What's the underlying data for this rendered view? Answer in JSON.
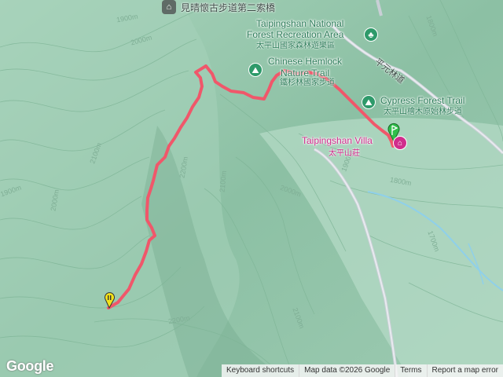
{
  "map": {
    "pois": {
      "bridge": {
        "name": "見晴懷古步道第二索橋",
        "icon": "bridge-icon"
      },
      "recreation_area": {
        "name_en_1": "Taipingshan National",
        "name_en_2": "Forest Recreation Area",
        "name_zh": "太平山國家森林遊樂區",
        "icon": "tree-icon"
      },
      "hemlock_trail": {
        "name_en_1": "Chinese Hemlock",
        "name_en_2": "Nature Trail",
        "name_zh": "鐵杉林國家步道",
        "icon": "hiking-icon"
      },
      "cypress_trail": {
        "name_en": "Cypress Forest Trail",
        "name_zh": "太平山檜木原始林步道",
        "icon": "hiking-icon"
      },
      "villa": {
        "name_en": "Taipingshan Villa",
        "name_zh": "太平山莊",
        "icon": "hotel-icon"
      }
    },
    "road_label": "平元林道",
    "contour_labels": [
      "1900m",
      "2000m",
      "1800m",
      "2100m",
      "2200m",
      "1900m",
      "2000m",
      "2100m",
      "2000m",
      "1900m",
      "1800m",
      "1700m",
      "2100m",
      "2200m"
    ],
    "colors": {
      "track": "#f0576a",
      "start_marker": "#2fbf4a",
      "end_marker": "#f3e21a",
      "terrain": "#8fc3a6",
      "water": "#8fd0ea",
      "poi_green": "#2e9a6a",
      "villa_pink": "#d02c8c"
    }
  },
  "footer": {
    "logo": "Google",
    "keyboard_shortcuts": "Keyboard shortcuts",
    "map_data": "Map data ©2026 Google",
    "terms": "Terms",
    "report": "Report a map error"
  }
}
